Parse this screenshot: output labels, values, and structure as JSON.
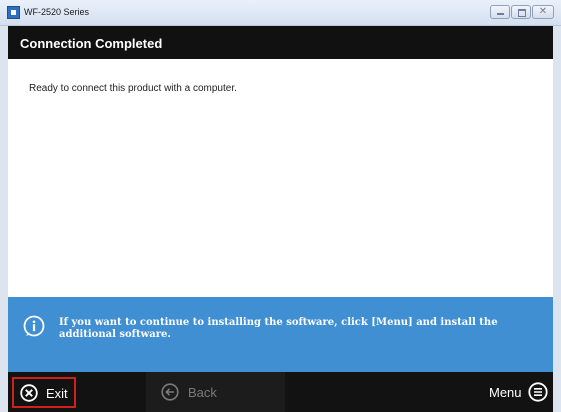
{
  "window": {
    "title": "WF-2520 Series",
    "close_glyph": "✕"
  },
  "header": {
    "title": "Connection Completed"
  },
  "content": {
    "message": "Ready to connect this product with a computer."
  },
  "info": {
    "icon": "info-icon",
    "text": "If you want to continue to installing the software, click [Menu] and install the additional software."
  },
  "footer": {
    "exit_label": "Exit",
    "back_label": "Back",
    "menu_label": "Menu"
  },
  "colors": {
    "header_bg": "#111111",
    "info_bg": "#3f8fd2",
    "footer_bg": "#121212",
    "exit_highlight": "#d0201a"
  }
}
